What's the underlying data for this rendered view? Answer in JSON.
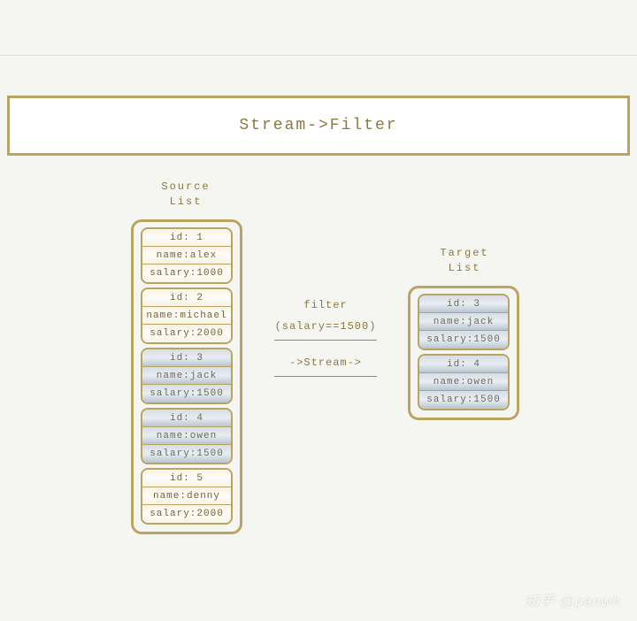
{
  "title": "Stream->Filter",
  "source": {
    "label": "Source\nList",
    "records": [
      {
        "id": "id: 1",
        "name": "name:alex",
        "salary": "salary:1000",
        "highlight": false
      },
      {
        "id": "id: 2",
        "name": "name:michael",
        "salary": "salary:2000",
        "highlight": false
      },
      {
        "id": "id: 3",
        "name": "name:jack",
        "salary": "salary:1500",
        "highlight": true
      },
      {
        "id": "id: 4",
        "name": "name:owen",
        "salary": "salary:1500",
        "highlight": true
      },
      {
        "id": "id: 5",
        "name": "name:denny",
        "salary": "salary:2000",
        "highlight": false
      }
    ]
  },
  "target": {
    "label": "Target\nList",
    "records": [
      {
        "id": "id: 3",
        "name": "name:jack",
        "salary": "salary:1500",
        "highlight": true
      },
      {
        "id": "id: 4",
        "name": "name:owen",
        "salary": "salary:1500",
        "highlight": true
      }
    ]
  },
  "filter": {
    "word": "filter",
    "condition": "(salary==1500)",
    "stream": "->Stream->"
  },
  "watermark": "知乎 @panwh"
}
